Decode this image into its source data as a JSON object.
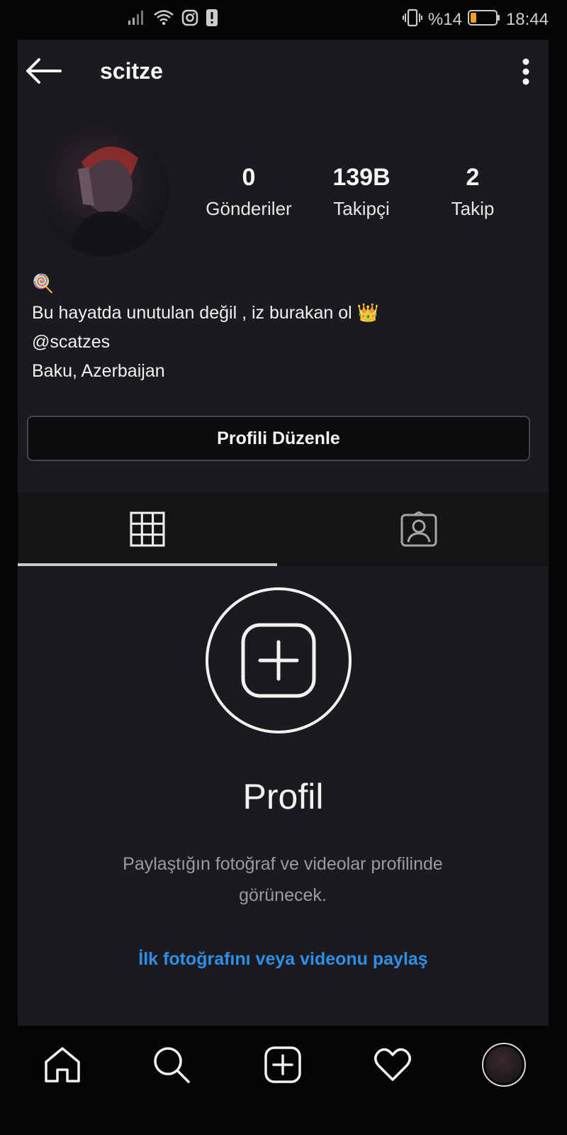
{
  "status_bar": {
    "battery_percent": "%14",
    "time": "18:44",
    "icons": [
      "signal-icon",
      "wifi-icon",
      "instagram-notification-icon",
      "alert-icon",
      "vibrate-icon",
      "battery-icon"
    ]
  },
  "header": {
    "username": "scitze"
  },
  "profile": {
    "stats": [
      {
        "value": "0",
        "label": "Gönderiler"
      },
      {
        "value": "139B",
        "label": "Takipçi"
      },
      {
        "value": "2",
        "label": "Takip"
      }
    ],
    "bio": {
      "line1": "🍭",
      "line2": "Bu hayatda unutulan değil , iz burakan ol 👑",
      "line3": "@scatzes",
      "line4": "Baku, Azerbaijan"
    },
    "edit_button": "Profili Düzenle"
  },
  "tabs": {
    "active_index": 0,
    "items": [
      "grid-icon",
      "tagged-person-icon"
    ]
  },
  "empty_state": {
    "title": "Profil",
    "description": "Paylaştığın fotoğraf ve videolar profilinde görünecek.",
    "link": "İlk fotoğrafını veya videonu paylaş"
  },
  "bottom_nav": {
    "items": [
      "home-icon",
      "search-icon",
      "new-post-icon",
      "activity-heart-icon",
      "profile-avatar"
    ]
  },
  "colors": {
    "background": "#050505",
    "panel": "#1b1b1f",
    "link": "#2f8fe8",
    "battery_low": "#f0a020"
  }
}
